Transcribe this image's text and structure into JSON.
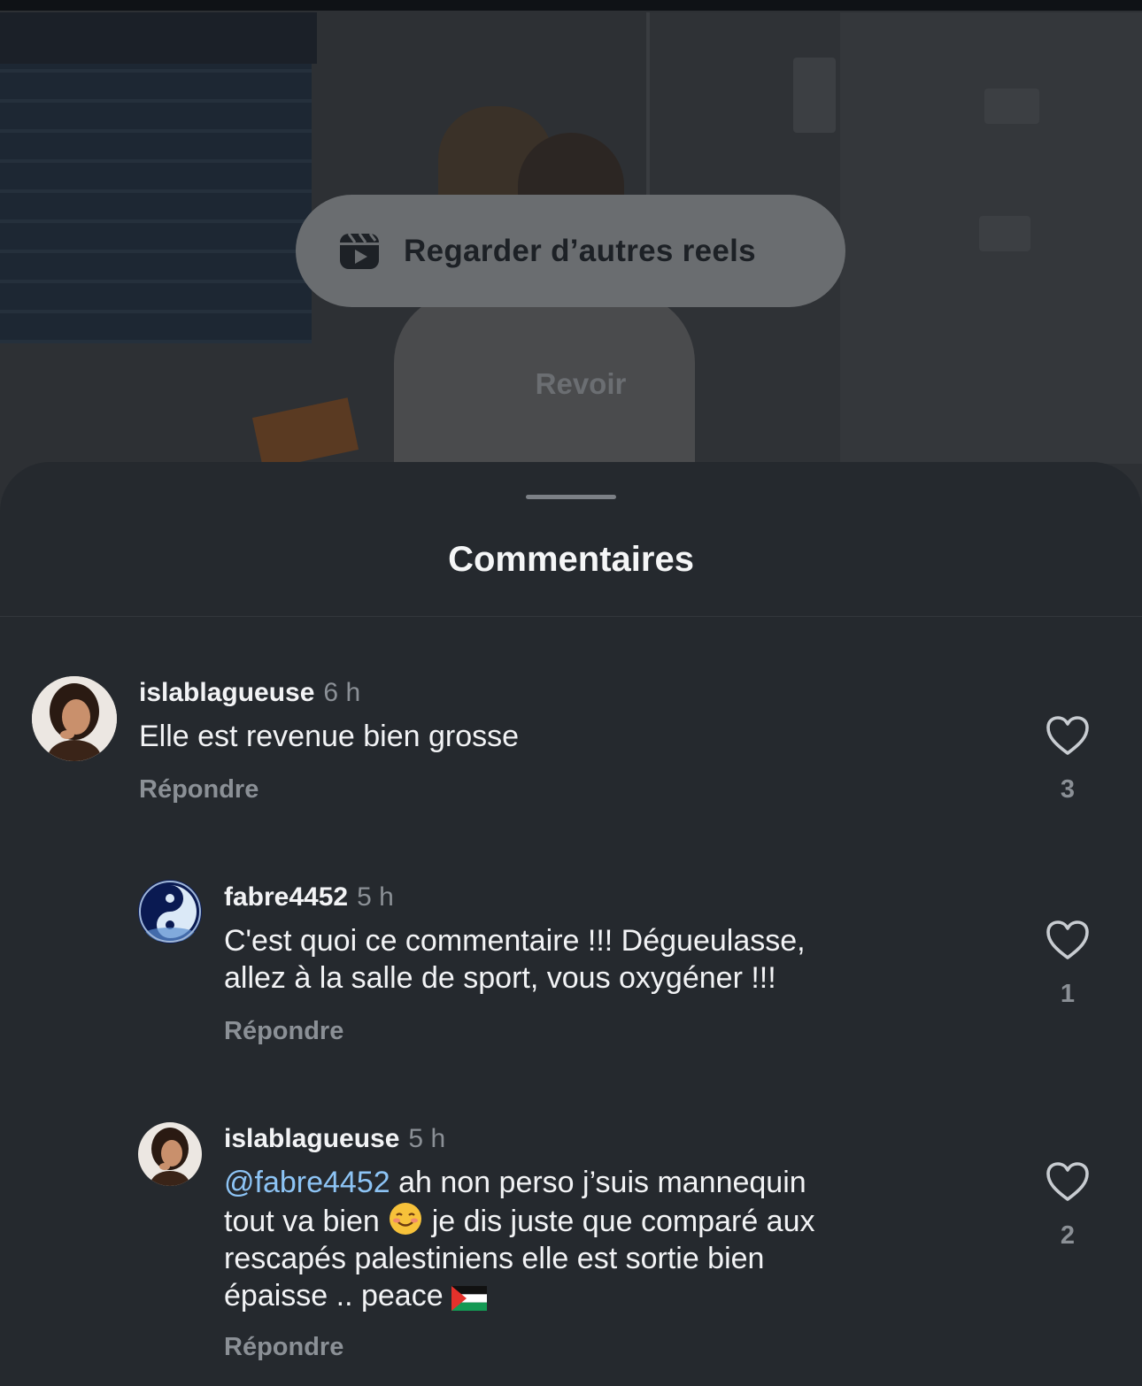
{
  "video": {
    "watch_more_label": "Regarder d’autres reels",
    "watch_more_icon": "reels-icon",
    "replay_label": "Revoir"
  },
  "sheet": {
    "title": "Commentaires"
  },
  "comments": [
    {
      "username": "islablagueuse",
      "time": "6 h",
      "text": "Elle est revenue bien grosse",
      "reply_label": "Répondre",
      "likes": "3"
    },
    {
      "username": "fabre4452",
      "time": "5 h",
      "text_line1": "C'est quoi ce commentaire !!! Dégueulasse,",
      "text_line2": "allez à la salle de sport, vous oxygéner !!!",
      "reply_label": "Répondre",
      "likes": "1"
    },
    {
      "username": "islablagueuse",
      "time": "5 h",
      "mention": "@fabre4452",
      "text_part1": " ah non perso j’suis mannequin",
      "text_part2": "tout va bien",
      "text_part3": " je dis juste que comparé aux",
      "text_part4": "rescapés palestiniens elle est sortie bien",
      "text_part5": "épaisse .. peace",
      "reply_label": "Répondre",
      "likes": "2"
    }
  ],
  "colors": {
    "background": "#25292e",
    "mention": "#8dc4f5",
    "muted": "#8b9096"
  }
}
